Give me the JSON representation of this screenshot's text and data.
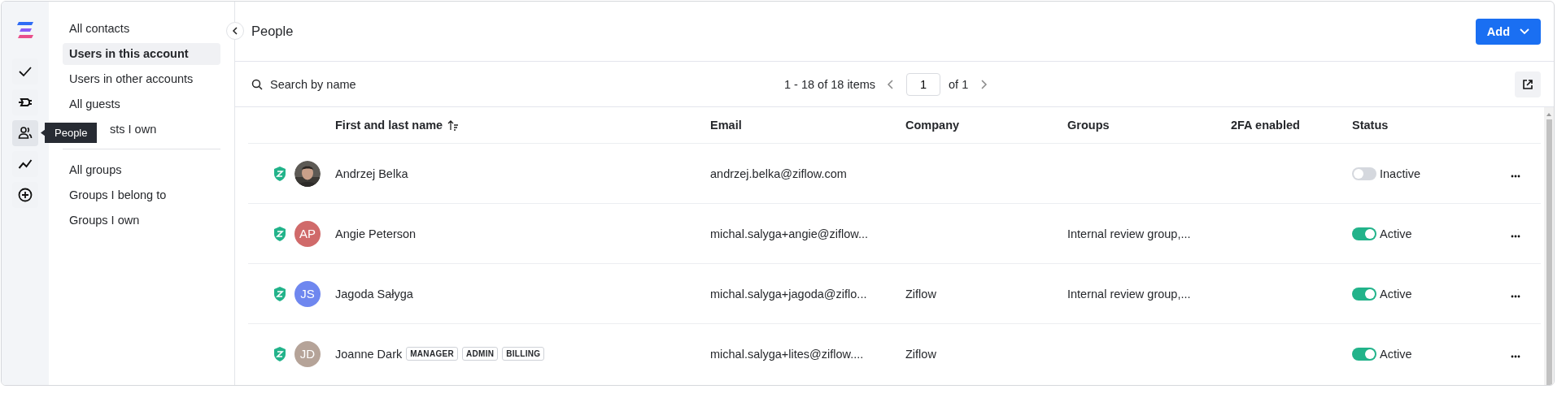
{
  "rail": {
    "items": [
      {
        "selected": false
      },
      {
        "selected": false
      },
      {
        "selected": true
      },
      {
        "selected": false
      },
      {
        "selected": false
      }
    ],
    "tooltip": "People"
  },
  "sidebar": {
    "sections": [
      [
        {
          "label": "All contacts",
          "selected": false
        },
        {
          "label": "Users in this account",
          "selected": true
        },
        {
          "label": "Users in other accounts",
          "selected": false
        },
        {
          "label": "All guests",
          "selected": false
        },
        {
          "label": "sts I own",
          "selected": false
        }
      ],
      [
        {
          "label": "All groups",
          "selected": false
        },
        {
          "label": "Groups I belong to",
          "selected": false
        },
        {
          "label": "Groups I own",
          "selected": false
        }
      ]
    ]
  },
  "header": {
    "title": "People",
    "add_button": "Add"
  },
  "toolbar": {
    "search_placeholder": "Search by name",
    "range": "1 - 18 of 18 items",
    "page": "1",
    "of": "of 1"
  },
  "table": {
    "columns": [
      "First and last name",
      "Email",
      "Company",
      "Groups",
      "2FA enabled",
      "Status"
    ],
    "rows": [
      {
        "name": "Andrzej Belka",
        "tags": [],
        "email": "andrzej.belka@ziflow.com",
        "company": "",
        "groups": "",
        "status": {
          "on": false,
          "label": "Inactive"
        }
      },
      {
        "avatar": {
          "kind": "initials",
          "initials": "AP",
          "color": "#d06a6a"
        },
        "name": "Angie Peterson",
        "tags": [],
        "email": "michal.salyga+angie@ziflow...",
        "company": "",
        "groups": "Internal review group,...",
        "status": {
          "on": true,
          "label": "Active"
        }
      },
      {
        "avatar": {
          "kind": "initials",
          "initials": "JS",
          "color": "#6f87ef"
        },
        "name": "Jagoda Sałyga",
        "tags": [],
        "email": "michal.salyga+jagoda@ziflo...",
        "company": "Ziflow",
        "groups": "Internal review group,...",
        "status": {
          "on": true,
          "label": "Active"
        }
      },
      {
        "avatar": {
          "kind": "initials",
          "initials": "JD",
          "color": "#b5a398"
        },
        "name": "Joanne Dark",
        "tags": [
          "MANAGER",
          "ADMIN",
          "BILLING"
        ],
        "email": "michal.salyga+lites@ziflow....",
        "company": "Ziflow",
        "groups": "",
        "status": {
          "on": true,
          "label": "Active"
        }
      }
    ]
  }
}
